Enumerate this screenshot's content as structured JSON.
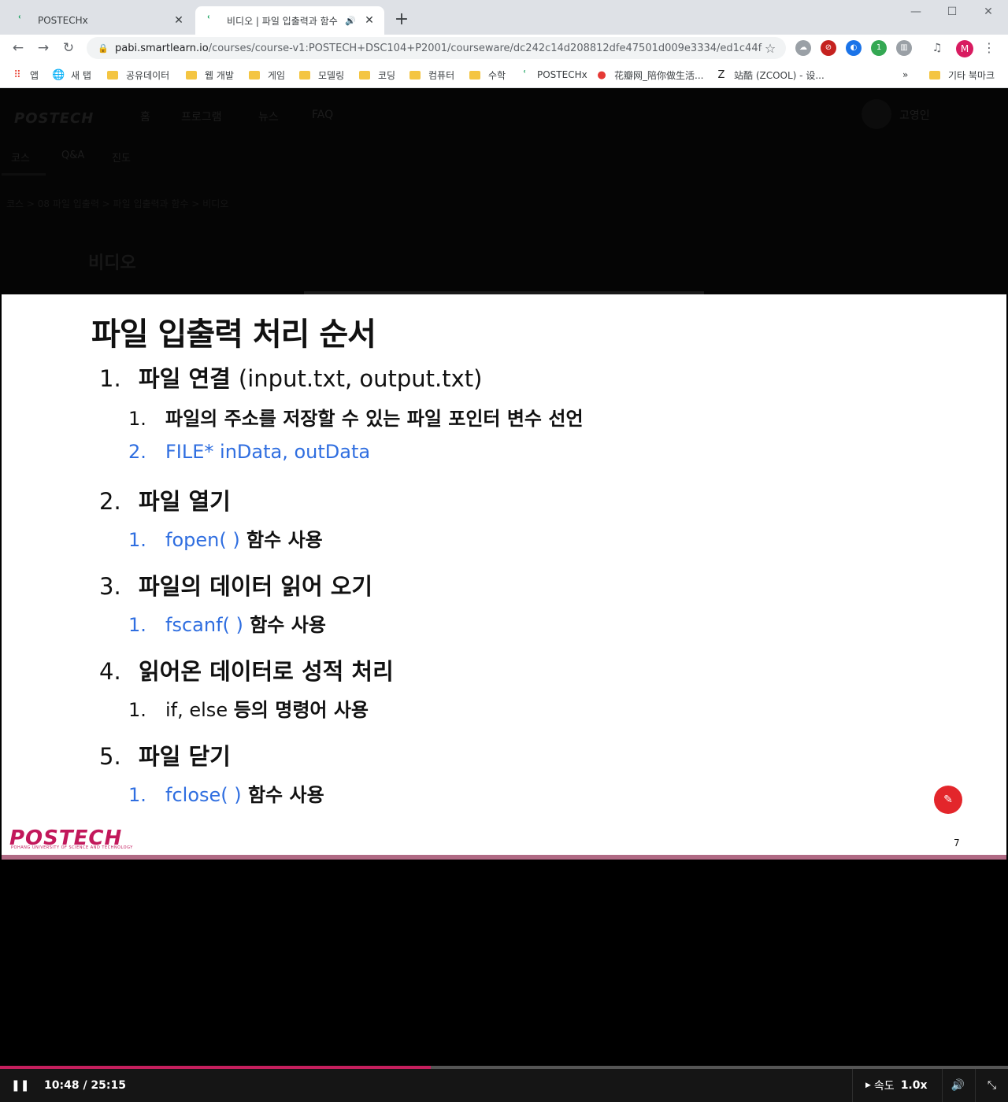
{
  "browser": {
    "tabs": [
      {
        "title": "POSTECHx",
        "close": "✕"
      },
      {
        "title": "비디오 | 파일 입출력과 함수",
        "audio": "🔊",
        "close": "✕"
      }
    ],
    "new_tab": "+",
    "window_controls": {
      "minimize": "—",
      "maximize": "☐",
      "close": "✕"
    },
    "url_host": "pabi.smartlearn.io",
    "url_path": "/courses/course-v1:POSTECH+DSC104+P2001/courseware/dc242c14d208812dfe47501d009e3334/ed1c44fd8a1...",
    "profile_initial": "M",
    "extension_badge": "1",
    "bookmarks": [
      {
        "label": "앱",
        "icon": "apps-icon"
      },
      {
        "label": "새 탭",
        "icon": "globe-icon"
      },
      {
        "label": "공유데이터",
        "icon": "folder-icon"
      },
      {
        "label": "웹 개발",
        "icon": "folder-icon"
      },
      {
        "label": "게임",
        "icon": "folder-icon"
      },
      {
        "label": "모델링",
        "icon": "folder-icon"
      },
      {
        "label": "코딩",
        "icon": "folder-icon"
      },
      {
        "label": "컴퓨터",
        "icon": "folder-icon"
      },
      {
        "label": "수학",
        "icon": "folder-icon"
      },
      {
        "label": "POSTECHx",
        "icon": "postechx-icon"
      },
      {
        "label": "花瓣网_陪你做生活...",
        "icon": "huaban-icon"
      },
      {
        "label": "站酷 (ZCOOL) - 设...",
        "icon": "zcool-icon"
      }
    ],
    "bookmarks_overflow": "»",
    "other_bookmarks": "기타 북마크"
  },
  "site": {
    "logo": "POSTECH",
    "nav": [
      "홈",
      "프로그램",
      "뉴스",
      "FAQ"
    ],
    "username": "고영인",
    "subnav": [
      "코스",
      "Q&A",
      "진도"
    ],
    "breadcrumb": "코스 > 08 파일 입출력 > 파일 입출력과 함수 > 비디오",
    "unit_title": "비디오"
  },
  "slide": {
    "title": "파일 입출력 처리 순서",
    "items": [
      {
        "num": "1.",
        "text": "파일 연결 ",
        "text_light": "(input.txt, output.txt)",
        "subs": [
          {
            "num": "1.",
            "text": "파일의 주소를 저장할 수 있는 파일 포인터 변수 선언"
          },
          {
            "num": "2.",
            "code": "FILE* inData, outData"
          }
        ]
      },
      {
        "num": "2.",
        "text": "파일 열기",
        "subs": [
          {
            "num": "1.",
            "code": "fopen( )",
            "text": " 함수 사용"
          }
        ]
      },
      {
        "num": "3.",
        "text": "파일의 데이터 읽어 오기",
        "subs": [
          {
            "num": "1.",
            "code": "fscanf( )",
            "text": " 함수 사용"
          }
        ]
      },
      {
        "num": "4.",
        "text": "읽어온 데이터로 성적 처리",
        "subs": [
          {
            "num": "1.",
            "plain": "if, else ",
            "text": "등의 명령어 사용"
          }
        ]
      },
      {
        "num": "5.",
        "text": "파일 닫기",
        "subs": [
          {
            "num": "1.",
            "code": "fclose( )",
            "text": " 함수 사용"
          }
        ]
      }
    ],
    "logo": "POSTECH",
    "logo_sub": "POHANG UNIVERSITY OF SCIENCE AND TECHNOLOGY",
    "page_number": "7"
  },
  "player": {
    "time": "10:48 / 25:15",
    "progress": 0.4277,
    "speed_label": "속도",
    "speed_value": "1.0x"
  },
  "colors": {
    "accent": "#c51f5d",
    "slide_code": "#2f6ee0",
    "slide_logo": "#c2185b"
  }
}
